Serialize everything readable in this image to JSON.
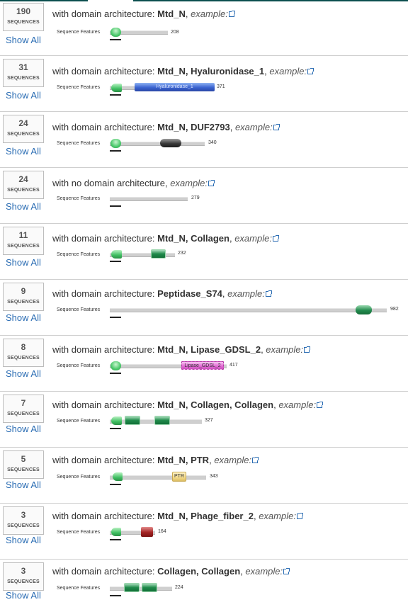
{
  "common": {
    "sequences_label": "SEQUENCES",
    "show_all": "Show All",
    "sequence_features": "Sequence Features",
    "example": "example:"
  },
  "rows": [
    {
      "count": "190",
      "prefix": "with domain architecture: ",
      "arch": "Mtd_N",
      "length": "208"
    },
    {
      "count": "31",
      "prefix": "with domain architecture: ",
      "arch": "Mtd_N, Hyaluronidase_1",
      "length": "371",
      "domain_labels": [
        "Hyaluronidase_1"
      ]
    },
    {
      "count": "24",
      "prefix": "with domain architecture: ",
      "arch": "Mtd_N, DUF2793",
      "length": "340"
    },
    {
      "count": "24",
      "prefix": "with no domain architecture",
      "arch": "",
      "length": "279"
    },
    {
      "count": "11",
      "prefix": "with domain architecture: ",
      "arch": "Mtd_N, Collagen",
      "length": "232"
    },
    {
      "count": "9",
      "prefix": "with domain architecture: ",
      "arch": "Peptidase_S74",
      "length": "982"
    },
    {
      "count": "8",
      "prefix": "with domain architecture: ",
      "arch": "Mtd_N, Lipase_GDSL_2",
      "length": "417",
      "domain_labels": [
        "Lipase_GDSL_2"
      ]
    },
    {
      "count": "7",
      "prefix": "with domain architecture: ",
      "arch": "Mtd_N, Collagen, Collagen",
      "length": "327"
    },
    {
      "count": "5",
      "prefix": "with domain architecture: ",
      "arch": "Mtd_N, PTR",
      "length": "343",
      "domain_labels": [
        "PTR"
      ]
    },
    {
      "count": "3",
      "prefix": "with domain architecture: ",
      "arch": "Mtd_N, Phage_fiber_2",
      "length": "164"
    },
    {
      "count": "3",
      "prefix": "with domain architecture: ",
      "arch": "Collagen, Collagen",
      "length": "224"
    }
  ],
  "colors": {
    "Mtd_N": "#49c86a",
    "Hyaluronidase_1": "#3a63d0",
    "DUF2793": "#3a3a3a",
    "Collagen": "#1f8a4a",
    "Peptidase_S74": "#238b4e",
    "Lipase_GDSL_2": "#e56fd7",
    "PTR": "#f2d98a",
    "Phage_fiber_2": "#a32323",
    "link": "#2a6cb3"
  }
}
